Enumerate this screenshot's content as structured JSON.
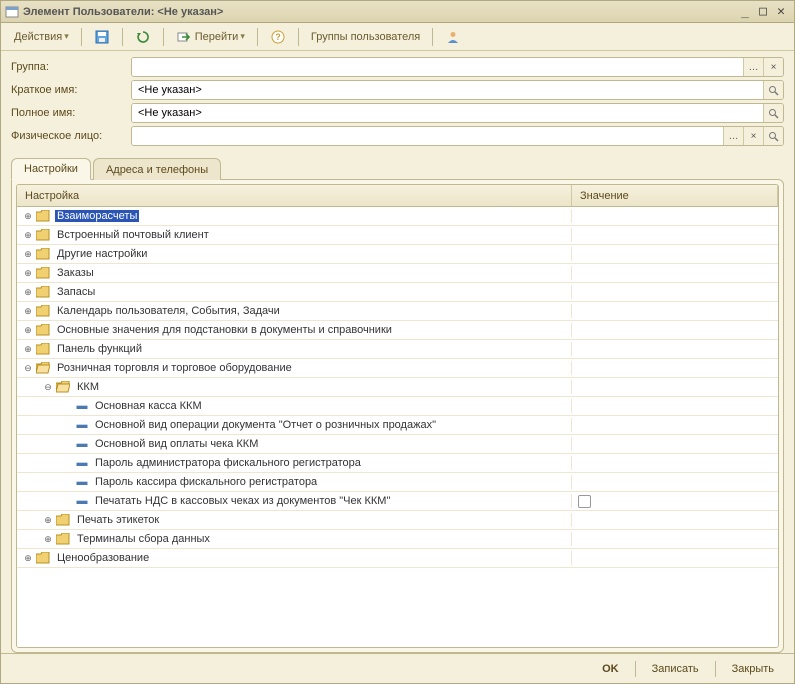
{
  "window": {
    "title": "Элемент Пользователи: <Не указан>"
  },
  "toolbar": {
    "actions_label": "Действия",
    "goto_label": "Перейти",
    "groups_label": "Группы пользователя"
  },
  "form": {
    "group_label": "Группа:",
    "group_value": "",
    "short_name_label": "Краткое имя:",
    "short_name_value": "<Не указан>",
    "full_name_label": "Полное имя:",
    "full_name_value": "<Не указан>",
    "person_label": "Физическое лицо:",
    "person_value": ""
  },
  "tabs": {
    "settings": "Настройки",
    "addresses": "Адреса и телефоны"
  },
  "grid": {
    "col_setting": "Настройка",
    "col_value": "Значение"
  },
  "tree": {
    "n0": "Взаиморасчеты",
    "n1": "Встроенный почтовый клиент",
    "n2": "Другие настройки",
    "n3": "Заказы",
    "n4": "Запасы",
    "n5": "Календарь пользователя, События, Задачи",
    "n6": "Основные значения для подстановки в документы и справочники",
    "n7": "Панель функций",
    "n8": "Розничная торговля и торговое оборудование",
    "n8_0": "ККМ",
    "n8_0_0": "Основная касса ККМ",
    "n8_0_1": "Основной вид операции документа \"Отчет о розничных продажах\"",
    "n8_0_2": "Основной вид оплаты чека ККМ",
    "n8_0_3": "Пароль администратора фискального регистратора",
    "n8_0_4": "Пароль кассира фискального регистратора",
    "n8_0_5": "Печатать НДС в кассовых чеках из документов \"Чек ККМ\"",
    "n8_1": "Печать этикеток",
    "n8_2": "Терминалы сбора данных",
    "n9": "Ценообразование"
  },
  "footer": {
    "ok": "OK",
    "save": "Записать",
    "close": "Закрыть"
  }
}
